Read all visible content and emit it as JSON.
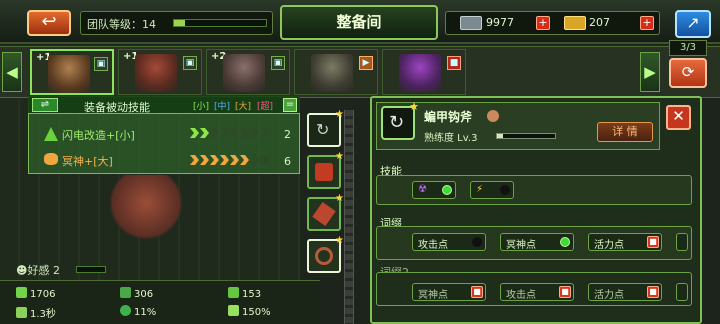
{
  "topbar": {
    "back_icon": "↩",
    "team_label": "团队等级：14",
    "team_progress": 0.12,
    "title": "整备间",
    "currency": [
      {
        "icon": "cash-icon",
        "value": "9977"
      },
      {
        "icon": "gold-icon",
        "value": "207"
      }
    ],
    "plus": "+",
    "exit_icon": "↗"
  },
  "roster": {
    "counter": "3/3",
    "prev": "◀",
    "next": "▶",
    "slots": [
      {
        "num": "+1",
        "color": "#a86a3a"
      },
      {
        "num": "+1",
        "color": "#8a3c2f"
      },
      {
        "num": "+2",
        "color": "#6b5a55"
      },
      {
        "num": "",
        "color": "#5b5a4a"
      },
      {
        "num": "",
        "color": "#6c2f8c"
      }
    ]
  },
  "skills": {
    "swap": "⇌",
    "header": "装备被动技能",
    "tiers": [
      "[小]",
      "[中]",
      "[大]",
      "[超]"
    ],
    "eq": "=",
    "rows": [
      {
        "name": "闪电改造+[小]",
        "count": "2",
        "color": "#8be64a"
      },
      {
        "name": "冥神+[大]",
        "count": "6",
        "color": "#f0a640"
      }
    ]
  },
  "hero": {
    "favor": "好感 2"
  },
  "stats": [
    {
      "icon": "hp-icon",
      "value": "1706"
    },
    {
      "icon": "armor-icon",
      "value": "306"
    },
    {
      "icon": "attack-icon",
      "value": "153"
    },
    {
      "icon": "speed-icon",
      "value": "1.3秒"
    },
    {
      "icon": "crit-icon",
      "value": "11%"
    },
    {
      "icon": "crit-damage-icon",
      "value": "150%"
    }
  ],
  "detail": {
    "weapon_name": "蝙甲钩斧",
    "proficiency": "熟练度 Lv.3",
    "detail_button": "详 情",
    "close": "✕",
    "skill_label": "技能",
    "affix_label": "词缀",
    "affix2_label": "词缀2",
    "affix_row1": [
      {
        "label": "攻击点",
        "state": "off"
      },
      {
        "label": "冥神点",
        "state": "on"
      },
      {
        "label": "活力点",
        "state": "lock"
      }
    ],
    "affix_row2": [
      {
        "label": "冥神点",
        "state": "lock"
      },
      {
        "label": "攻击点",
        "state": "lock"
      },
      {
        "label": "活力点",
        "state": "lock"
      }
    ]
  }
}
